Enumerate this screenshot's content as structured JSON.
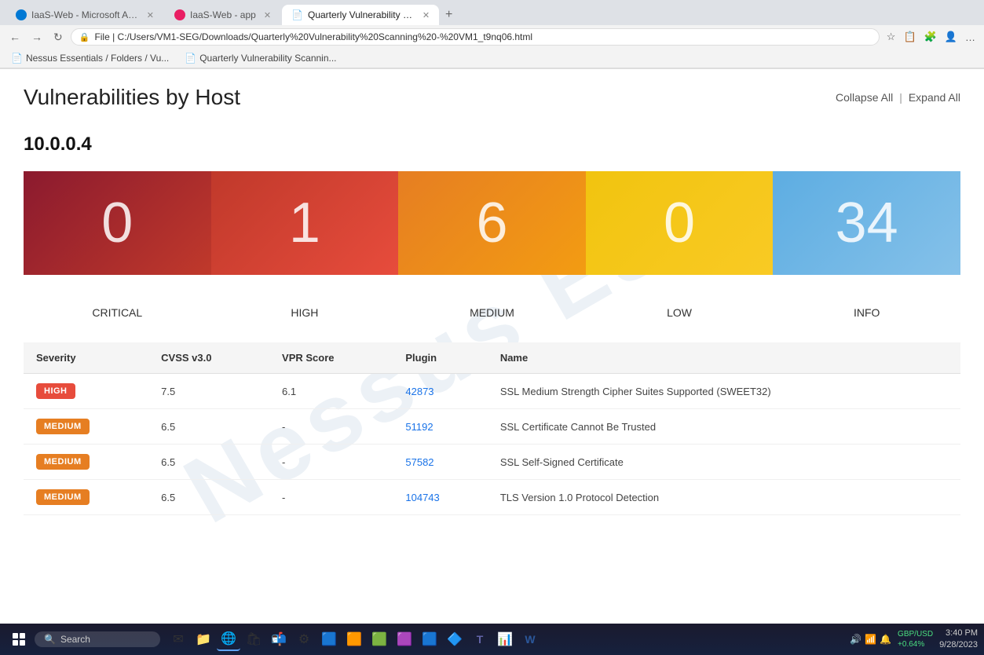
{
  "browser": {
    "tabs": [
      {
        "id": "tab1",
        "title": "IaaS-Web - Microsoft Azure",
        "active": false,
        "favicon": "A"
      },
      {
        "id": "tab2",
        "title": "IaaS-Web - app",
        "active": false,
        "favicon": "E"
      },
      {
        "id": "tab3",
        "title": "Quarterly Vulnerability Scannin...",
        "active": true,
        "favicon": "📄"
      }
    ],
    "address": "C:/Users/VM1-SEG/Downloads/Quarterly%20Vulnerability%20Scanning%20-%20VM1_t9nq06.html",
    "address_display": "File  |  C:/Users/VM1-SEG/Downloads/Quarterly%20Vulnerability%20Scanning%20-%20VM1_t9nq06.html",
    "bookmarks": [
      {
        "label": "Nessus Essentials / Folders / Vu..."
      },
      {
        "label": "Quarterly Vulnerability Scannin..."
      }
    ]
  },
  "page": {
    "title": "Vulnerabilities by Host",
    "collapse_label": "Collapse All",
    "expand_label": "Expand All",
    "separator": "|"
  },
  "host": {
    "ip": "10.0.0.4"
  },
  "severity_cards": [
    {
      "id": "critical",
      "number": "0",
      "label": "CRITICAL",
      "class": "critical"
    },
    {
      "id": "high",
      "number": "1",
      "label": "HIGH",
      "class": "high"
    },
    {
      "id": "medium",
      "number": "6",
      "label": "MEDIUM",
      "class": "medium"
    },
    {
      "id": "low",
      "number": "0",
      "label": "LOW",
      "class": "low"
    },
    {
      "id": "info",
      "number": "34",
      "label": "INFO",
      "class": "info"
    }
  ],
  "table": {
    "headers": [
      "Severity",
      "CVSS v3.0",
      "VPR Score",
      "Plugin",
      "Name"
    ],
    "rows": [
      {
        "severity": "HIGH",
        "severity_class": "badge-high",
        "cvss": "7.5",
        "vpr": "6.1",
        "plugin": "42873",
        "name": "SSL Medium Strength Cipher Suites Supported (SWEET32)"
      },
      {
        "severity": "MEDIUM",
        "severity_class": "badge-medium",
        "cvss": "6.5",
        "vpr": "-",
        "plugin": "51192",
        "name": "SSL Certificate Cannot Be Trusted"
      },
      {
        "severity": "MEDIUM",
        "severity_class": "badge-medium",
        "cvss": "6.5",
        "vpr": "-",
        "plugin": "57582",
        "name": "SSL Self-Signed Certificate"
      },
      {
        "severity": "MEDIUM",
        "severity_class": "badge-medium",
        "cvss": "6.5",
        "vpr": "-",
        "plugin": "104743",
        "name": "TLS Version 1.0 Protocol Detection"
      }
    ]
  },
  "taskbar": {
    "search_placeholder": "Search",
    "time": "3:40 PM",
    "date": "9/28/2023",
    "stock": {
      "symbol": "GBP/USD",
      "change": "+0.64%"
    },
    "apps": [
      {
        "name": "file-explorer",
        "icon": "📁"
      },
      {
        "name": "edge-browser",
        "icon": "🌐",
        "active": true
      },
      {
        "name": "notepad",
        "icon": "📝"
      },
      {
        "name": "terminal",
        "icon": "⬛"
      },
      {
        "name": "teams",
        "icon": "T"
      },
      {
        "name": "settings",
        "icon": "⚙"
      },
      {
        "name": "app7",
        "icon": "🟦"
      },
      {
        "name": "app8",
        "icon": "🟥"
      },
      {
        "name": "app9",
        "icon": "🟩"
      },
      {
        "name": "app10",
        "icon": "🟪"
      },
      {
        "name": "app11",
        "icon": "🔶"
      },
      {
        "name": "app12",
        "icon": "🔷"
      },
      {
        "name": "app13",
        "icon": "📊"
      },
      {
        "name": "app14",
        "icon": "📋"
      },
      {
        "name": "word",
        "icon": "W"
      }
    ]
  },
  "watermark_text": "Nessus Ess..."
}
